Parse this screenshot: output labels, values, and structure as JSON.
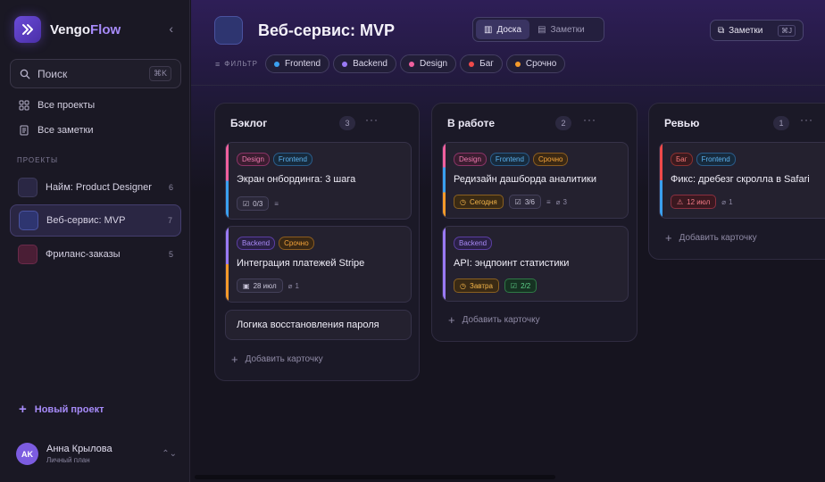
{
  "app": {
    "brand_part1": "Vengo",
    "brand_part2": "Flow",
    "search_label": "Поиск",
    "search_kbd": "⌘K"
  },
  "nav": {
    "all_projects": "Все проекты",
    "all_notes": "Все заметки"
  },
  "projects_section": "ПРОЕКТЫ",
  "projects": [
    {
      "name": "Найм: Product Designer",
      "count": "6",
      "color": "#2a2744"
    },
    {
      "name": "Веб-сервис: MVP",
      "count": "7",
      "color": "#2e3570"
    },
    {
      "name": "Фриланс-заказы",
      "count": "5",
      "color": "#4a1e35"
    }
  ],
  "new_project": "Новый проект",
  "user": {
    "initials": "AK",
    "name": "Анна Крылова",
    "plan": "Личный план"
  },
  "header": {
    "title": "Веб-сервис: MVP",
    "view_board": "Доска",
    "view_notes": "Заметки",
    "notes_button": "Заметки",
    "notes_kbd": "⌘J",
    "filter_label": "ФИЛЬТР"
  },
  "filters": [
    {
      "label": "Frontend",
      "color": "#3aa0f0"
    },
    {
      "label": "Backend",
      "color": "#9a7af5"
    },
    {
      "label": "Design",
      "color": "#f0609e"
    },
    {
      "label": "Баг",
      "color": "#f04a4a"
    },
    {
      "label": "Срочно",
      "color": "#f59a2a"
    }
  ],
  "add_card": "Добавить карточку",
  "columns": [
    {
      "title": "Бэклог",
      "count": "3",
      "cards": [
        {
          "title": "Экран онбординга: 3 шага",
          "tags": [
            "Design",
            "Frontend"
          ],
          "checklist": "0/3"
        },
        {
          "title": "Интеграция платежей Stripe",
          "tags": [
            "Backend",
            "Срочно"
          ],
          "date": "28 июл",
          "attachments": "1"
        },
        {
          "title": "Логика восстановления пароля"
        }
      ]
    },
    {
      "title": "В работе",
      "count": "2",
      "cards": [
        {
          "title": "Редизайн дашборда аналитики",
          "tags": [
            "Design",
            "Frontend",
            "Срочно"
          ],
          "date": "Сегодня",
          "checklist": "3/6",
          "attachments": "3"
        },
        {
          "title": "API: эндпоинт статистики",
          "tags": [
            "Backend"
          ],
          "date": "Завтра",
          "checklist": "2/2"
        }
      ]
    },
    {
      "title": "Ревью",
      "count": "1",
      "cards": [
        {
          "title": "Фикс: дребезг скролла в Safari",
          "tags": [
            "Баг",
            "Frontend"
          ],
          "date": "12 июл",
          "attachments": "1"
        }
      ]
    }
  ]
}
